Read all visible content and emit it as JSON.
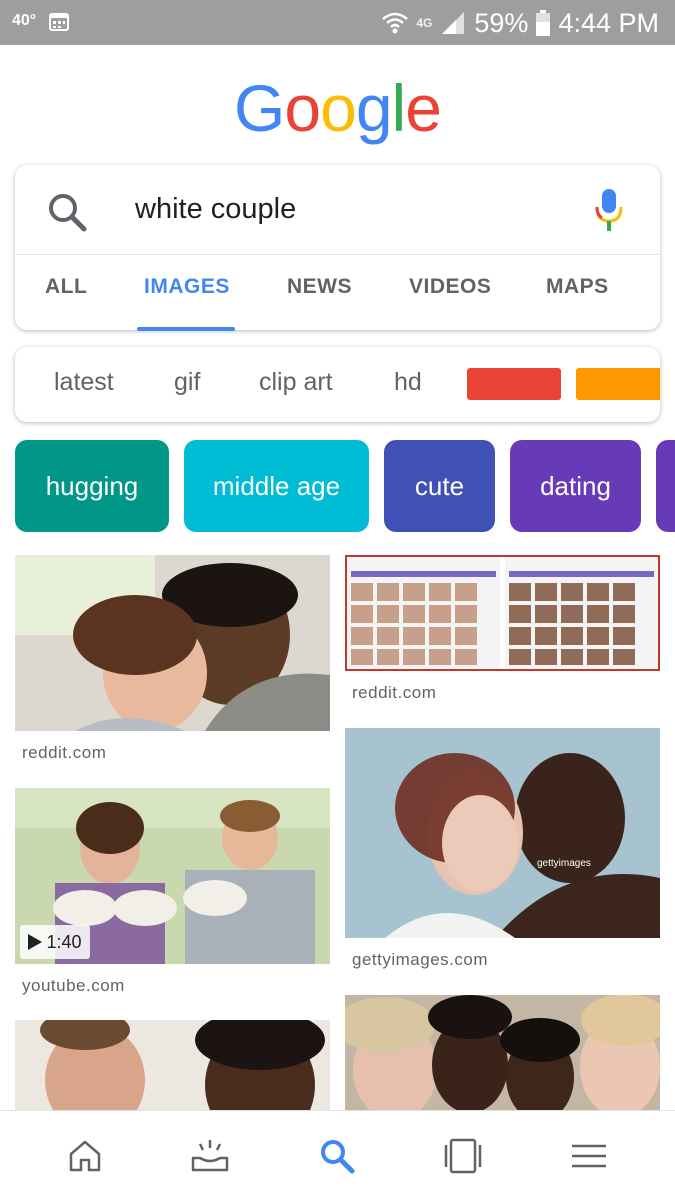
{
  "status_bar": {
    "temperature": "40°",
    "network": "4G",
    "battery": "59%",
    "time": "4:44 PM"
  },
  "logo": {
    "letters": [
      "G",
      "o",
      "o",
      "g",
      "l",
      "e"
    ]
  },
  "search": {
    "query": "white couple"
  },
  "tabs": [
    {
      "label": "ALL",
      "active": false
    },
    {
      "label": "IMAGES",
      "active": true
    },
    {
      "label": "NEWS",
      "active": false
    },
    {
      "label": "VIDEOS",
      "active": false
    },
    {
      "label": "MAPS",
      "active": false
    }
  ],
  "suggestions": [
    "latest",
    "gif",
    "clip art",
    "hd"
  ],
  "color_filters": [
    "#ea4335",
    "#ff9800"
  ],
  "related": [
    {
      "label": "hugging",
      "color": "#009688"
    },
    {
      "label": "middle age",
      "color": "#00bcd4"
    },
    {
      "label": "cute",
      "color": "#3f51b5"
    },
    {
      "label": "dating",
      "color": "#673ab7"
    }
  ],
  "results": [
    {
      "source": "reddit.com"
    },
    {
      "source": "reddit.com"
    },
    {
      "source": "youtube.com",
      "duration": "1:40"
    },
    {
      "source": "gettyimages.com",
      "watermark": "gettyimages"
    }
  ],
  "bottom_nav": [
    "home-icon",
    "updates-icon",
    "search-icon",
    "tabs-icon",
    "menu-icon"
  ]
}
